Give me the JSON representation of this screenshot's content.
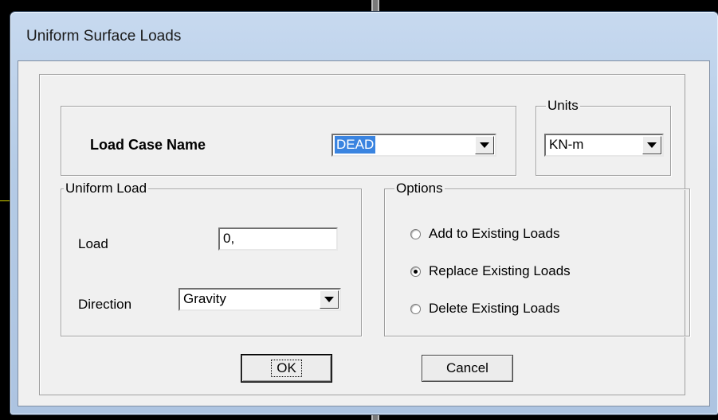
{
  "window": {
    "title": "Uniform Surface Loads"
  },
  "load_case": {
    "label": "Load Case Name",
    "selected": "DEAD"
  },
  "units": {
    "legend": "Units",
    "selected": "KN-m"
  },
  "uniform_load": {
    "legend": "Uniform Load",
    "load_label": "Load",
    "load_value": "0,",
    "direction_label": "Direction",
    "direction_selected": "Gravity"
  },
  "options": {
    "legend": "Options",
    "items": [
      {
        "label": "Add to Existing Loads",
        "selected": false
      },
      {
        "label": "Replace Existing Loads",
        "selected": true
      },
      {
        "label": "Delete Existing Loads",
        "selected": false
      }
    ]
  },
  "buttons": {
    "ok": "OK",
    "cancel": "Cancel"
  },
  "icons": {
    "dropdown": "chevron-down-icon"
  }
}
